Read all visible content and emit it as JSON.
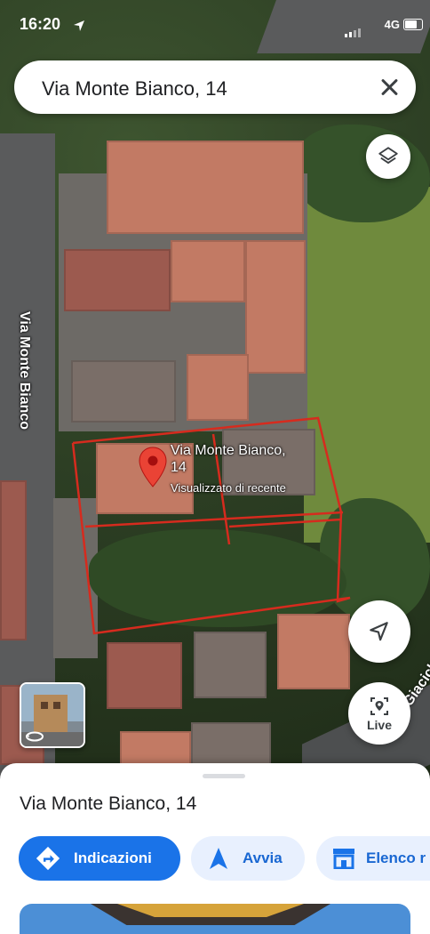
{
  "status_bar": {
    "time": "16:20",
    "network": "4G"
  },
  "search": {
    "query": "Via Monte Bianco, 14"
  },
  "map": {
    "street_label": "Via Monte Bianco",
    "street_label_2": "Giacich",
    "pin_title": "Via Monte Bianco,\n14",
    "pin_subtitle": "Visualizzato di recente",
    "live_label": "Live"
  },
  "sheet": {
    "title": "Via Monte Bianco, 14",
    "actions": [
      {
        "label": "Indicazioni",
        "icon": "directions-icon"
      },
      {
        "label": "Avvia",
        "icon": "navigation-arrow-icon"
      },
      {
        "label": "Elenco r",
        "icon": "list-icon"
      }
    ]
  },
  "colors": {
    "accent": "#1a73e8",
    "pin": "#ea4335",
    "boundary": "#d62b1e"
  }
}
